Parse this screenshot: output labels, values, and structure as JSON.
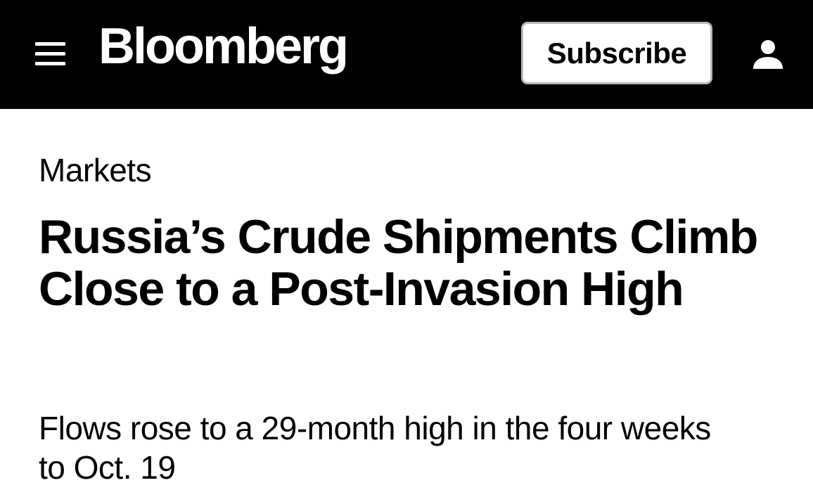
{
  "header": {
    "menu_icon": "hamburger-menu-icon",
    "logo_text": "Bloomberg",
    "subscribe_label": "Subscribe",
    "profile_icon": "user-profile-icon",
    "background_color": "#000000",
    "text_color": "#ffffff"
  },
  "article": {
    "section": "Markets",
    "headline": "Russia’s Crude Shipments Climb Close to a Post-Invasion High",
    "subheadline": "Flows rose to a 29-month high in the four weeks to Oct. 19"
  }
}
